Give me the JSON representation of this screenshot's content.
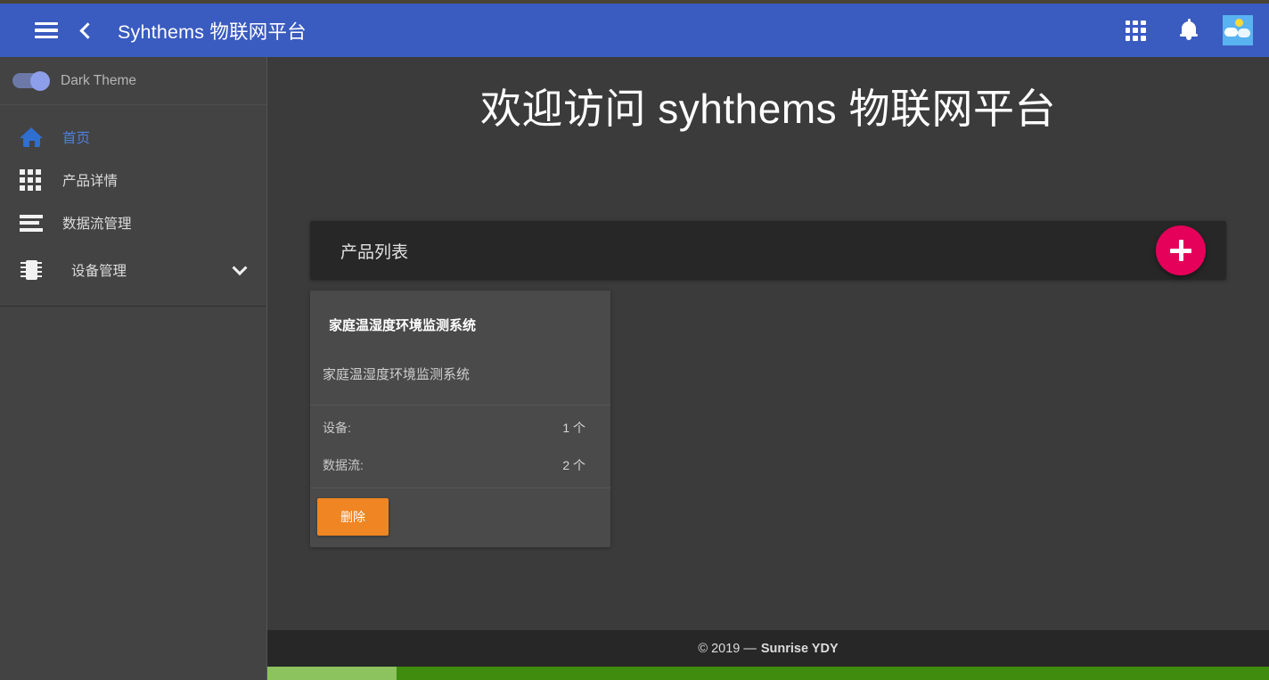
{
  "header": {
    "menu_icon": "hamburger-icon",
    "back_icon": "chevron-left-icon",
    "title": "Syhthems 物联网平台",
    "apps_icon": "grid-apps-icon",
    "notifications_icon": "bell-icon",
    "avatar_icon": "weather-avatar-icon"
  },
  "sidebar": {
    "theme_toggle": {
      "label": "Dark Theme",
      "state": "on",
      "accent": "#8d9eea"
    },
    "items": [
      {
        "label": "首页",
        "icon": "home-icon",
        "active": true,
        "expandable": false
      },
      {
        "label": "产品详情",
        "icon": "grid-icon",
        "active": false,
        "expandable": false
      },
      {
        "label": "数据流管理",
        "icon": "list-lines-icon",
        "active": false,
        "expandable": false
      },
      {
        "label": "设备管理",
        "icon": "chip-icon",
        "active": false,
        "expandable": true,
        "expand_icon": "chevron-down-icon"
      }
    ]
  },
  "main": {
    "page_title": "欢迎访问 syhthems 物联网平台",
    "toolbar": {
      "title": "产品列表",
      "add_button_icon": "plus-icon",
      "add_button_color": "#e5005a"
    },
    "products": [
      {
        "title": "家庭温湿度环境监测系统",
        "description": "家庭温湿度环境监测系统",
        "stats": [
          {
            "key": "设备:",
            "value": "1 个"
          },
          {
            "key": "数据流:",
            "value": "2 个"
          }
        ],
        "delete_label": "删除",
        "delete_color": "#ef8523"
      }
    ]
  },
  "footer": {
    "copyright": "© 2019 —",
    "brand": "Sunrise YDY"
  },
  "colors": {
    "header_blue": "#3a5bbf",
    "page_bg": "#3b3b3b",
    "sidebar_bg": "#434343",
    "panel_dark": "#272727",
    "card_bg": "#4a4a4a",
    "active_link": "#4e7fe0",
    "scrollbar_green": "#4aa212"
  }
}
